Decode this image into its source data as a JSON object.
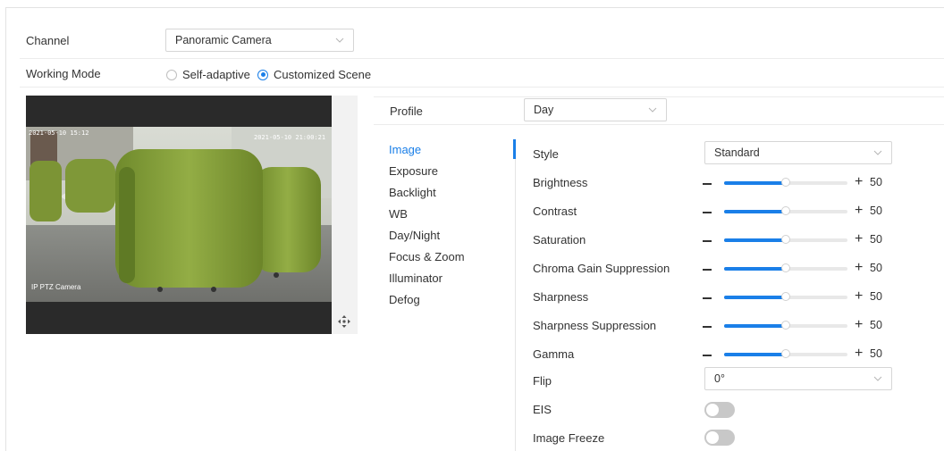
{
  "channel": {
    "label": "Channel",
    "value": "Panoramic Camera"
  },
  "working_mode": {
    "label": "Working Mode",
    "options": [
      {
        "label": "Self-adaptive",
        "selected": false
      },
      {
        "label": "Customized Scene",
        "selected": true
      }
    ]
  },
  "preview": {
    "timestamp": "2021-05-10 21:00:21",
    "osd_left": "2021-05-10 15:12",
    "camera_name": "IP PTZ Camera"
  },
  "profile": {
    "label": "Profile",
    "value": "Day"
  },
  "menu": {
    "items": [
      "Image",
      "Exposure",
      "Backlight",
      "WB",
      "Day/Night",
      "Focus & Zoom",
      "Illuminator",
      "Defog"
    ],
    "active": "Image"
  },
  "image": {
    "style": {
      "label": "Style",
      "value": "Standard"
    },
    "sliders": [
      {
        "label": "Brightness",
        "value": 50
      },
      {
        "label": "Contrast",
        "value": 50
      },
      {
        "label": "Saturation",
        "value": 50
      },
      {
        "label": "Chroma Gain Suppression",
        "value": 50
      },
      {
        "label": "Sharpness",
        "value": 50
      },
      {
        "label": "Sharpness Suppression",
        "value": 50
      },
      {
        "label": "Gamma",
        "value": 50
      }
    ],
    "flip": {
      "label": "Flip",
      "value": "0°"
    },
    "eis": {
      "label": "EIS",
      "on": false
    },
    "freeze": {
      "label": "Image Freeze",
      "on": false
    }
  },
  "colors": {
    "accent": "#1a7fe8",
    "toggle_off": "#c8c8c8"
  },
  "icons": {
    "dropdown": "chevron-down-icon",
    "move": "move-arrows-icon"
  }
}
